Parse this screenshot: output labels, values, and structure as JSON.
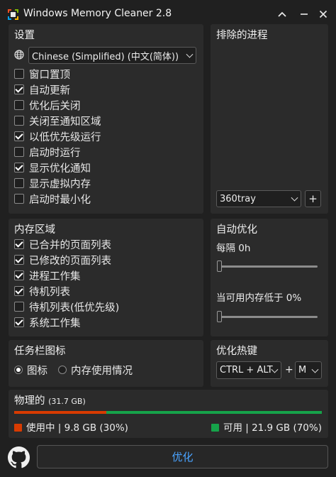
{
  "window": {
    "title": "Windows Memory Cleaner 2.8",
    "colors": {
      "background": "#202020",
      "panel": "#2b2b2b",
      "accent": "#4aa3ff",
      "used": "#d83b01",
      "free": "#16a34a"
    }
  },
  "settings": {
    "title": "设置",
    "language": "Chinese (Simplified) (中文(简体))",
    "options": [
      {
        "label": "窗口置顶",
        "checked": false
      },
      {
        "label": "自动更新",
        "checked": true
      },
      {
        "label": "优化后关闭",
        "checked": false
      },
      {
        "label": "关闭至通知区域",
        "checked": false
      },
      {
        "label": "以低优先级运行",
        "checked": true
      },
      {
        "label": "启动时运行",
        "checked": false
      },
      {
        "label": "显示优化通知",
        "checked": true
      },
      {
        "label": "显示虚拟内存",
        "checked": false
      },
      {
        "label": "启动时最小化",
        "checked": false
      }
    ]
  },
  "excluded": {
    "title": "排除的进程",
    "selected_process": "360tray",
    "add_label": "+"
  },
  "memory_areas": {
    "title": "内存区域",
    "options": [
      {
        "label": "已合并的页面列表",
        "checked": true
      },
      {
        "label": "已修改的页面列表",
        "checked": true
      },
      {
        "label": "进程工作集",
        "checked": true
      },
      {
        "label": "待机列表",
        "checked": true
      },
      {
        "label": "待机列表(低优先级)",
        "checked": false
      },
      {
        "label": "系统工作集",
        "checked": true
      }
    ]
  },
  "auto_optimize": {
    "title": "自动优化",
    "interval_label": "每隔 0h",
    "interval_value": 0,
    "threshold_label": "当可用内存低于 0%",
    "threshold_value": 0
  },
  "tray_icon": {
    "title": "任务栏图标",
    "options": [
      {
        "label": "图标",
        "selected": true
      },
      {
        "label": "内存使用情况",
        "selected": false
      }
    ]
  },
  "hotkey": {
    "title": "优化热键",
    "modifier": "CTRL + ALT",
    "plus": "+",
    "key": "M"
  },
  "physical": {
    "title": "物理的",
    "total": "(31.7 GB)",
    "used_fraction": 0.3,
    "used_label": "使用中 | 9.8 GB (30%)",
    "free_label": "可用 | 21.9 GB (70%)"
  },
  "actions": {
    "optimize_label": "优化"
  }
}
